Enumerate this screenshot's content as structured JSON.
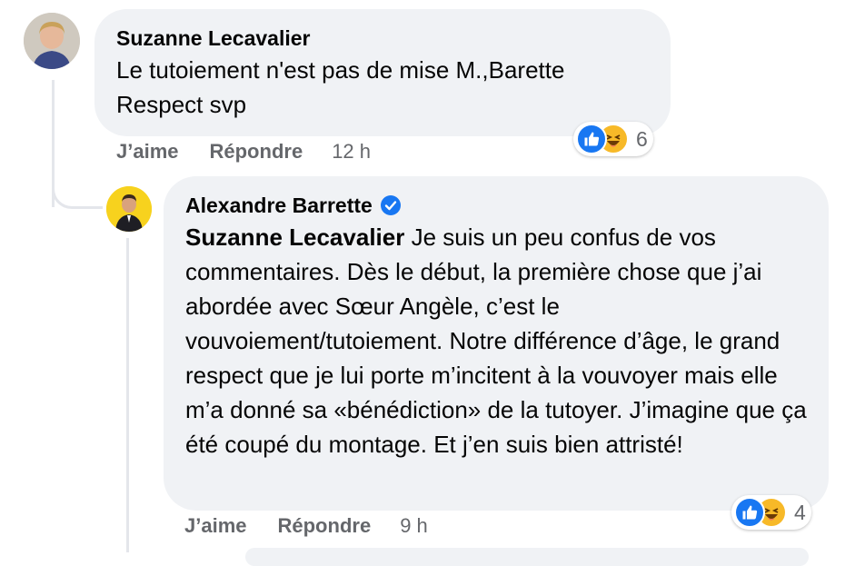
{
  "comments": [
    {
      "author": "Suzanne Lecavalier",
      "text": "Le tutoiement n'est pas de mise M.,Barette Respect svp",
      "reaction_count": "6",
      "like_label": "J’aime",
      "reply_label": "Répondre",
      "time": "12 h"
    },
    {
      "author": "Alexandre Barrette",
      "verified": true,
      "mention": "Suzanne Lecavalier",
      "text": "Je suis un peu confus de vos commentaires. Dès le début, la première chose que j’ai abordée avec Sœur Angèle, c’est le vouvoiement/tutoiement. Notre différence d’âge, le grand respect que je lui porte m’incitent à la vouvoyer mais elle m’a donné sa «bénédiction» de la tutoyer. J’imagine que ça été coupé du montage. Et j’en suis bien attristé!",
      "reaction_count": "4",
      "like_label": "J’aime",
      "reply_label": "Répondre",
      "time": "9 h"
    }
  ],
  "icons": {
    "reactions": [
      "like-icon",
      "haha-icon"
    ],
    "verified": "verified-badge-icon"
  },
  "colors": {
    "bubble": "#f0f2f5",
    "meta_text": "#65676b",
    "like_blue": "#1877f2",
    "haha_yellow": "#f7b928"
  }
}
